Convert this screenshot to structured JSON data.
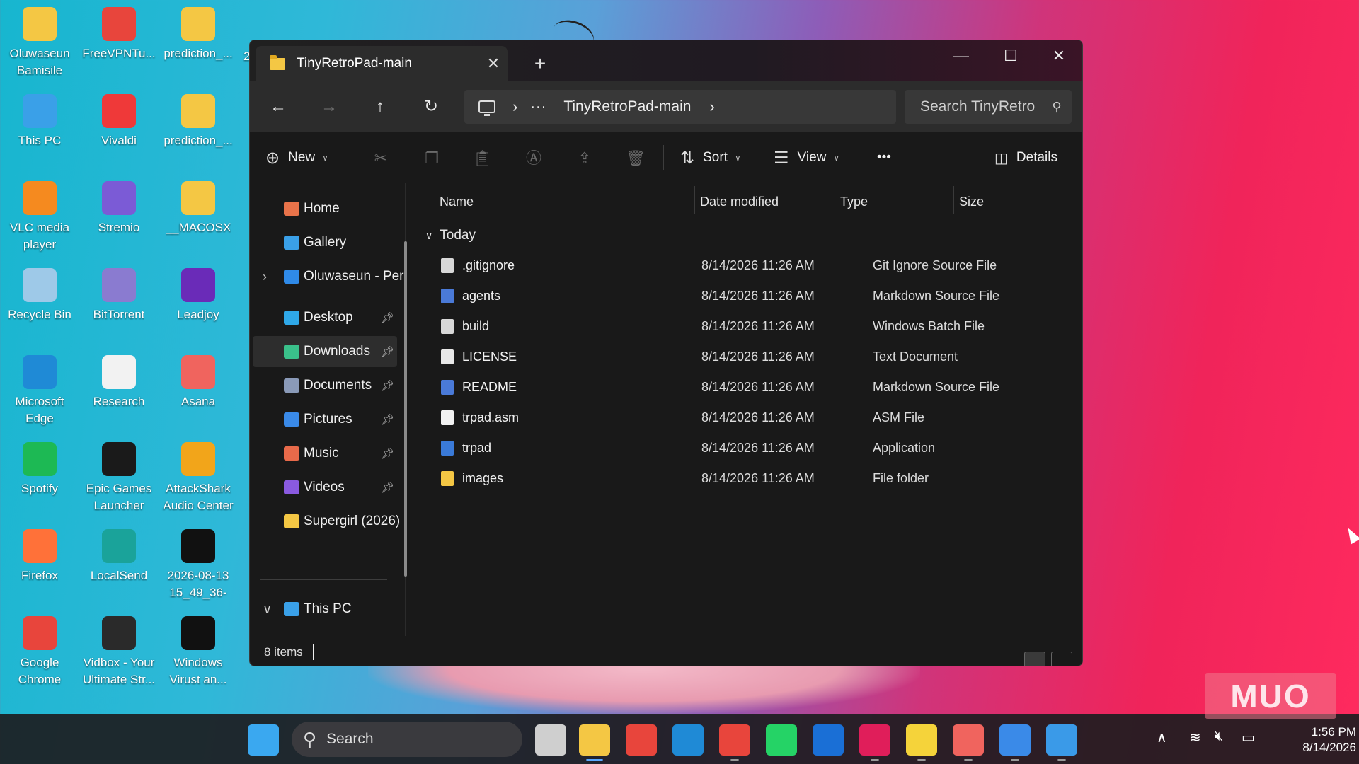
{
  "desktop": {
    "icons": [
      {
        "label": "Oluwaseun Bamisile",
        "icon": "folder-icon",
        "color": "#f4c744"
      },
      {
        "label": "FreeVPNTu...",
        "icon": "vpn-icon",
        "color": "#e8453c"
      },
      {
        "label": "prediction_...",
        "icon": "folder-zip-icon",
        "color": "#f4c744"
      },
      {
        "label": "This PC",
        "icon": "this-pc-icon",
        "color": "#3aa0e8"
      },
      {
        "label": "Vivaldi",
        "icon": "vivaldi-icon",
        "color": "#ef3939"
      },
      {
        "label": "prediction_...",
        "icon": "folder-icon",
        "color": "#f4c744"
      },
      {
        "label": "VLC media player",
        "icon": "vlc-icon",
        "color": "#f58a1f"
      },
      {
        "label": "Stremio",
        "icon": "stremio-icon",
        "color": "#7b5bd6"
      },
      {
        "label": "__MACOSX",
        "icon": "folder-icon",
        "color": "#f4c744"
      },
      {
        "label": "Recycle Bin",
        "icon": "recycle-bin-icon",
        "color": "#9ec9e8"
      },
      {
        "label": "BitTorrent",
        "icon": "bittorrent-icon",
        "color": "#8a7bd0"
      },
      {
        "label": "Leadjoy",
        "icon": "leadjoy-icon",
        "color": "#6a2bb8"
      },
      {
        "label": "Microsoft Edge",
        "icon": "edge-icon",
        "color": "#1f8ad6"
      },
      {
        "label": "Research",
        "icon": "document-icon",
        "color": "#f2f2f2"
      },
      {
        "label": "Asana",
        "icon": "asana-icon",
        "color": "#f0645e"
      },
      {
        "label": "Spotify",
        "icon": "spotify-icon",
        "color": "#1db954"
      },
      {
        "label": "Epic Games Launcher",
        "icon": "epic-games-icon",
        "color": "#1a1a1a"
      },
      {
        "label": "AttackShark Audio Center",
        "icon": "attackshark-icon",
        "color": "#f2a51a"
      },
      {
        "label": "Firefox",
        "icon": "firefox-icon",
        "color": "#ff7139"
      },
      {
        "label": "LocalSend",
        "icon": "localsend-icon",
        "color": "#1aa39a"
      },
      {
        "label": "2026-08-13 15_49_36-",
        "icon": "screenshot-thumb-icon",
        "color": "#111111"
      },
      {
        "label": "Google Chrome",
        "icon": "chrome-icon",
        "color": "#e8453c"
      },
      {
        "label": "Vidbox - Your Ultimate Str...",
        "icon": "vidbox-icon",
        "color": "#2a2a2a"
      },
      {
        "label": "Windows Virust an...",
        "icon": "screenshot-thumb-icon",
        "color": "#111111"
      }
    ],
    "partial_icon_label": "2"
  },
  "window": {
    "tab_title": "TinyRetroPad-main",
    "new_tab": "+",
    "minimize": "—",
    "maximize": "☐",
    "close": "✕",
    "address": {
      "sep": "›",
      "dots": "···",
      "crumb": "TinyRetroPad-main",
      "trail": "›"
    },
    "search_placeholder": "Search TinyRetro",
    "toolbar": {
      "new_label": "New",
      "sort_label": "Sort",
      "view_label": "View",
      "more_label": "•••",
      "details_label": "Details"
    },
    "sidebar": {
      "items": [
        {
          "label": "Home",
          "icon": "home-icon",
          "color": "#e8734a"
        },
        {
          "label": "Gallery",
          "icon": "gallery-icon",
          "color": "#3aa0e8"
        },
        {
          "label": "Oluwaseun - Per",
          "icon": "onedrive-icon",
          "color": "#2f8ae8"
        },
        {
          "label": "Desktop",
          "icon": "desktop-icon",
          "color": "#2fa8e8"
        },
        {
          "label": "Downloads",
          "icon": "download-icon",
          "color": "#3ac08a"
        },
        {
          "label": "Documents",
          "icon": "documents-icon",
          "color": "#8a9ab8"
        },
        {
          "label": "Pictures",
          "icon": "pictures-icon",
          "color": "#3a8ae8"
        },
        {
          "label": "Music",
          "icon": "music-icon",
          "color": "#e86a4a"
        },
        {
          "label": "Videos",
          "icon": "videos-icon",
          "color": "#8a5ae0"
        },
        {
          "label": "Supergirl (2026)",
          "icon": "folder-icon",
          "color": "#f4c744"
        },
        {
          "label": "This PC",
          "icon": "this-pc-icon",
          "color": "#3aa0e8"
        }
      ]
    },
    "columns": {
      "name": "Name",
      "date": "Date modified",
      "type": "Type",
      "size": "Size"
    },
    "group_label": "Today",
    "files": [
      {
        "name": ".gitignore",
        "date": "8/14/2026 11:26 AM",
        "type": "Git Ignore Source File",
        "icon": "gear-file-icon",
        "color": "#d8d8d8"
      },
      {
        "name": "agents",
        "date": "8/14/2026 11:26 AM",
        "type": "Markdown Source File",
        "icon": "markdown-file-icon",
        "color": "#4a7ad8"
      },
      {
        "name": "build",
        "date": "8/14/2026 11:26 AM",
        "type": "Windows Batch File",
        "icon": "batch-file-icon",
        "color": "#d8d8d8"
      },
      {
        "name": "LICENSE",
        "date": "8/14/2026 11:26 AM",
        "type": "Text Document",
        "icon": "text-file-icon",
        "color": "#e8e8e8"
      },
      {
        "name": "README",
        "date": "8/14/2026 11:26 AM",
        "type": "Markdown Source File",
        "icon": "markdown-file-icon",
        "color": "#4a7ad8"
      },
      {
        "name": "trpad.asm",
        "date": "8/14/2026 11:26 AM",
        "type": "ASM File",
        "icon": "blank-file-icon",
        "color": "#f2f2f2"
      },
      {
        "name": "trpad",
        "date": "8/14/2026 11:26 AM",
        "type": "Application",
        "icon": "application-icon",
        "color": "#3a7ad8"
      },
      {
        "name": "images",
        "date": "8/14/2026 11:26 AM",
        "type": "File folder",
        "icon": "folder-icon",
        "color": "#f4c744"
      }
    ],
    "status": "8 items"
  },
  "taskbar": {
    "search_label": "Search",
    "apps": [
      {
        "icon": "windows-start-icon",
        "color": "#3aa8f0"
      },
      {
        "icon": "task-view-icon",
        "color": "#cfcfcf"
      },
      {
        "icon": "file-explorer-icon",
        "color": "#f4c744"
      },
      {
        "icon": "microsoft-store-icon",
        "color": "#e8453c"
      },
      {
        "icon": "edge-icon",
        "color": "#1f8ad6"
      },
      {
        "icon": "chrome-icon",
        "color": "#e8453c"
      },
      {
        "icon": "whatsapp-icon",
        "color": "#25d366"
      },
      {
        "icon": "trello-icon",
        "color": "#1a6fd6"
      },
      {
        "icon": "slack-icon",
        "color": "#e01e5a"
      },
      {
        "icon": "sticky-notes-icon",
        "color": "#f5d33a"
      },
      {
        "icon": "asana-icon",
        "color": "#f0645e"
      },
      {
        "icon": "photos-icon",
        "color": "#3a8ae8"
      },
      {
        "icon": "notepad-icon",
        "color": "#3a9ae8"
      }
    ],
    "time": "1:56 PM",
    "date": "8/14/2026"
  },
  "watermark": "MUO"
}
